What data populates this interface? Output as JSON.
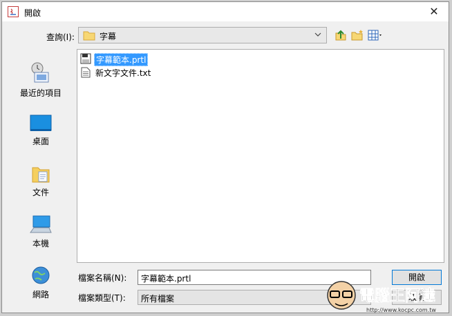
{
  "window": {
    "title": "開啟",
    "close_glyph": "✕"
  },
  "lookin": {
    "label": "查詢(I):",
    "value": "字幕"
  },
  "sidebar": {
    "items": [
      {
        "label": "最近的項目",
        "icon": "recent-items-icon"
      },
      {
        "label": "桌面",
        "icon": "desktop-icon"
      },
      {
        "label": "文件",
        "icon": "documents-icon"
      },
      {
        "label": "本機",
        "icon": "computer-icon"
      },
      {
        "label": "網路",
        "icon": "network-icon"
      }
    ]
  },
  "files": [
    {
      "name": "字幕範本.prtl",
      "selected": true
    },
    {
      "name": "新文字文件.txt",
      "selected": false
    }
  ],
  "form": {
    "filename_label": "檔案名稱(N):",
    "filename_value": "字幕範本.prtl",
    "filetype_label": "檔案類型(T):",
    "filetype_value": "所有檔案"
  },
  "buttons": {
    "open": "開啟",
    "cancel": "取消"
  },
  "watermark": {
    "text": "電腦王阿達",
    "url": "http://www.kocpc.com.tw"
  },
  "colors": {
    "selection": "#3399ff",
    "accent": "#0078d7"
  }
}
